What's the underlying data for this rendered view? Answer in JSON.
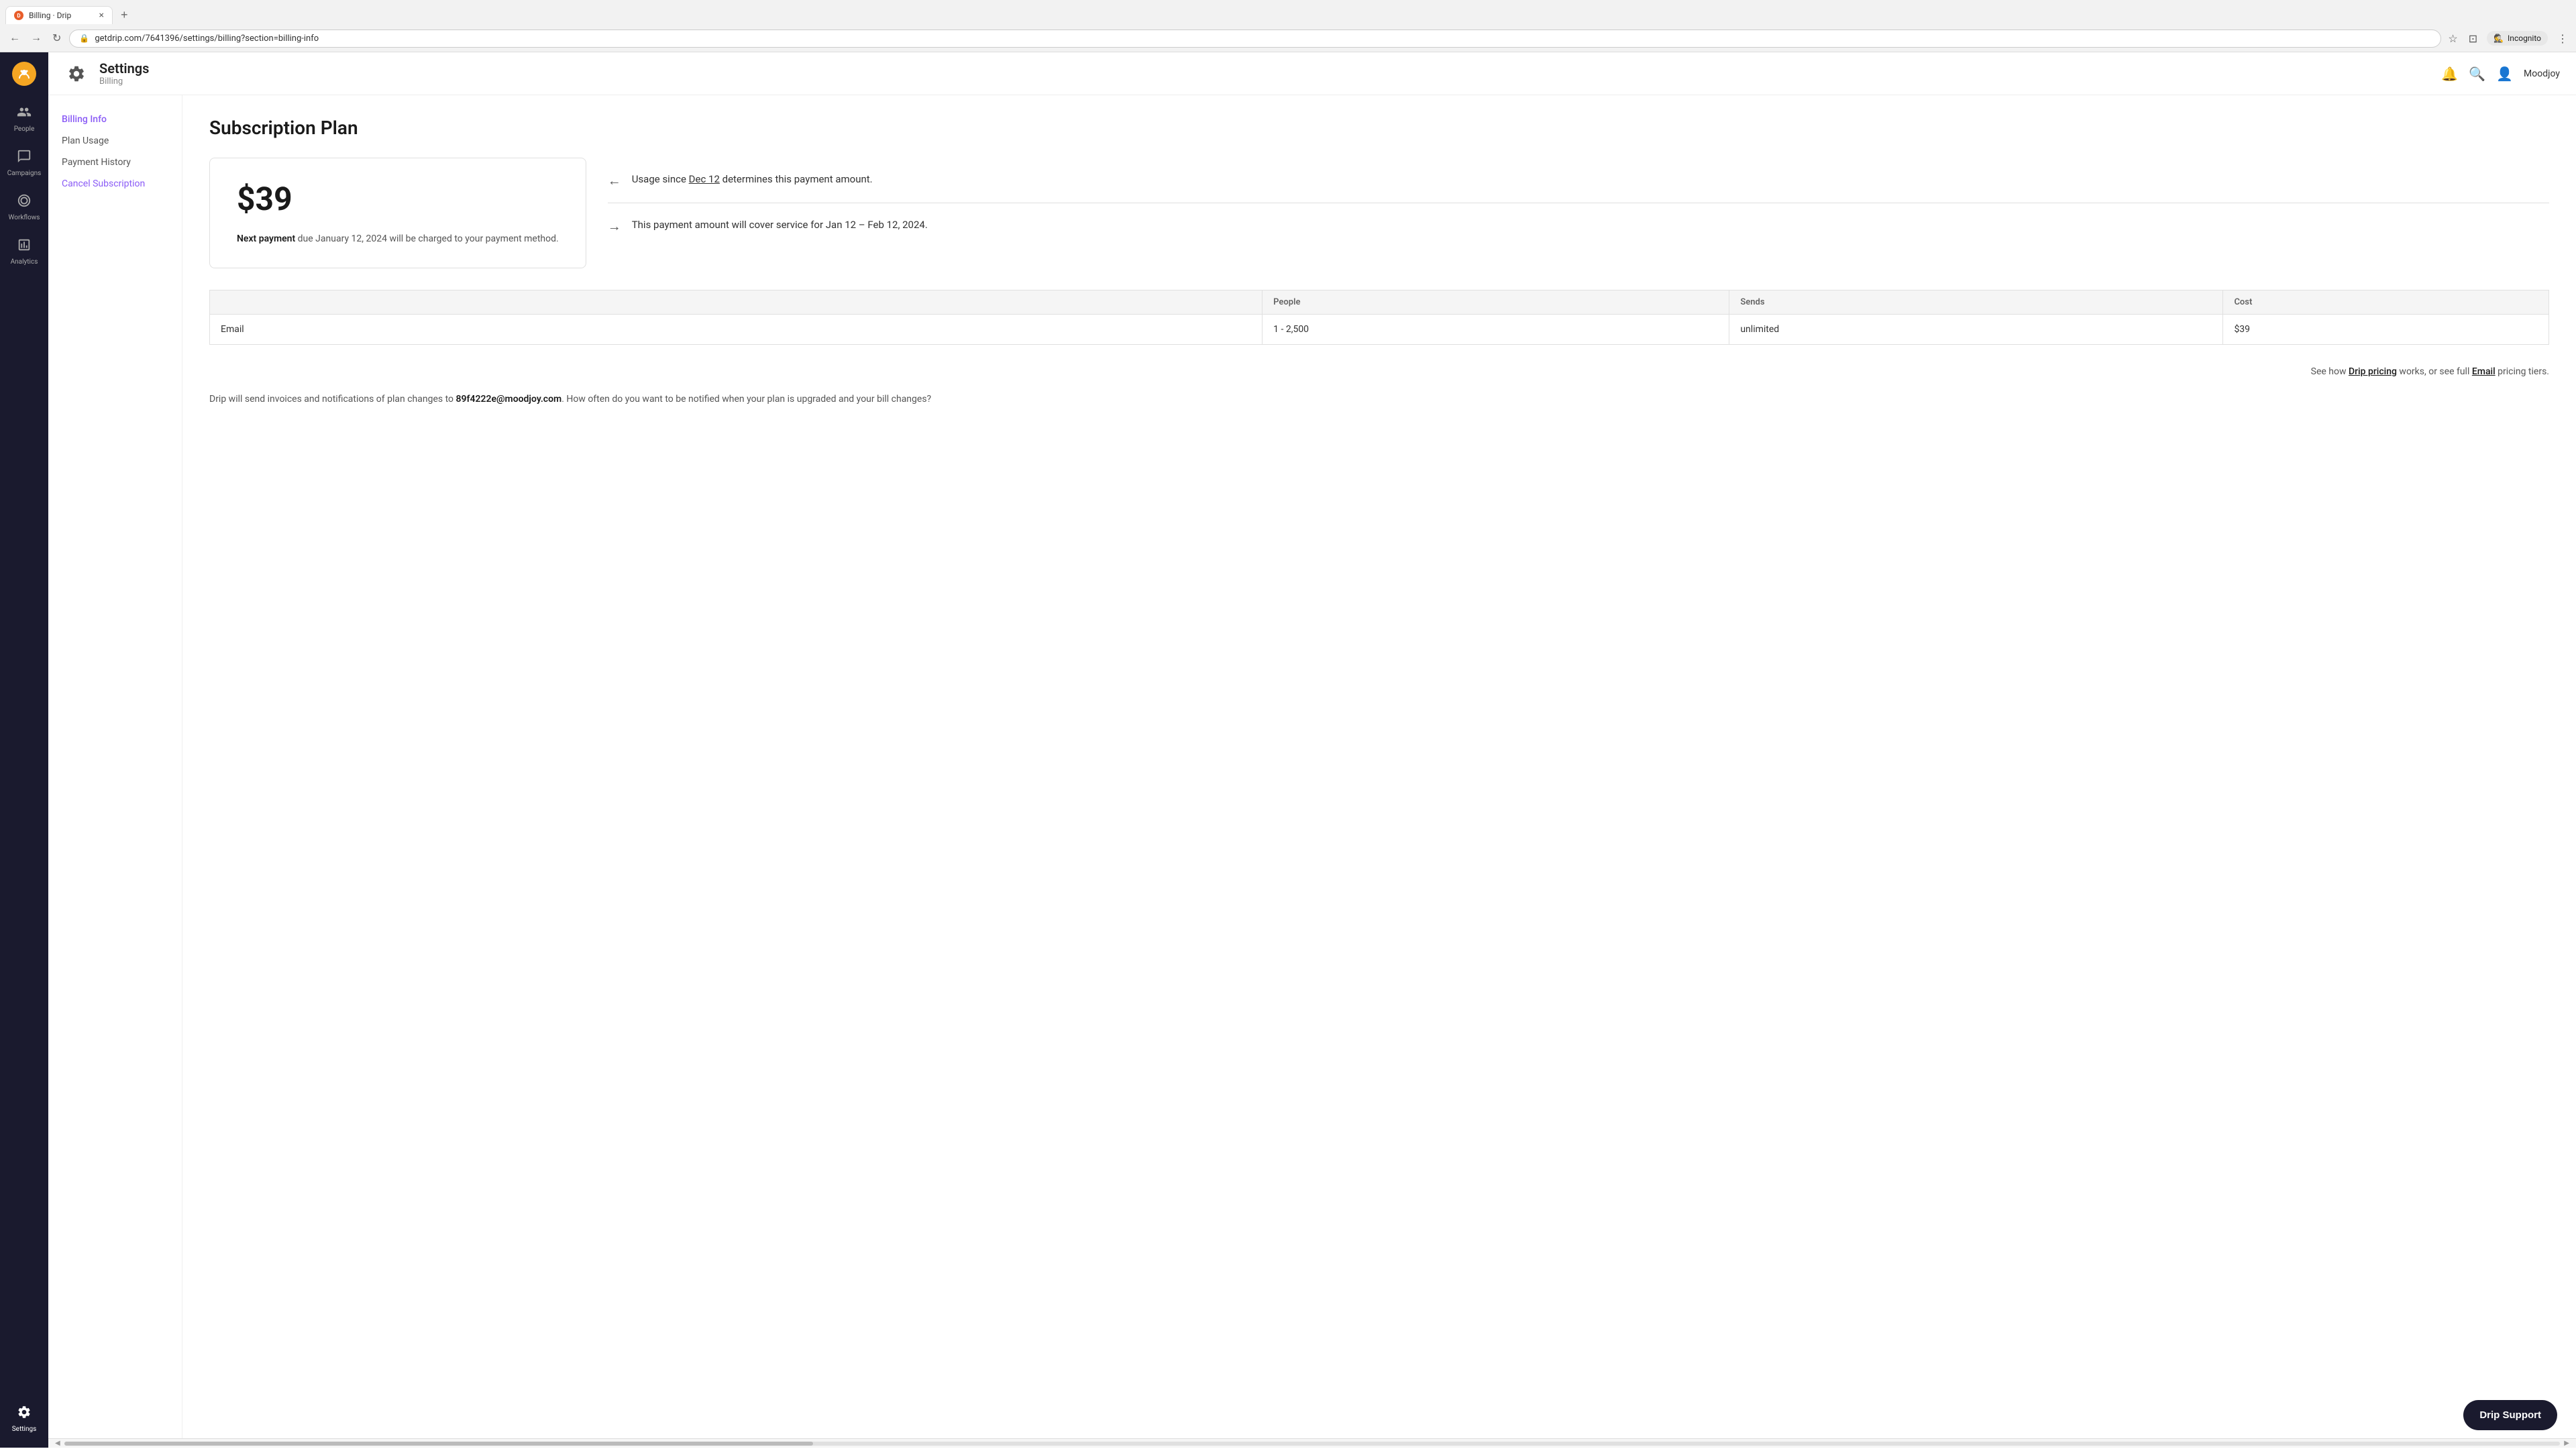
{
  "browser": {
    "tab_title": "Billing · Drip",
    "tab_close": "×",
    "new_tab": "+",
    "nav_back": "←",
    "nav_forward": "→",
    "nav_refresh": "↻",
    "address": "getdrip.com/7641396/settings/billing?section=billing-info",
    "incognito": "Incognito",
    "toolbar": {
      "star": "☆",
      "cast": "⊡",
      "menu": "⋮"
    }
  },
  "sidebar": {
    "logo": "☺",
    "items": [
      {
        "id": "people",
        "label": "People",
        "icon": "👥"
      },
      {
        "id": "campaigns",
        "label": "Campaigns",
        "icon": "📣"
      },
      {
        "id": "workflows",
        "label": "Workflows",
        "icon": "⬡"
      },
      {
        "id": "analytics",
        "label": "Analytics",
        "icon": "📊"
      }
    ],
    "settings": {
      "label": "Settings",
      "icon": "⚙"
    }
  },
  "header": {
    "settings_icon": "⚙",
    "title": "Settings",
    "subtitle": "Billing",
    "notification_icon": "🔔",
    "search_icon": "🔍",
    "user_icon": "👤",
    "user_name": "Moodjoy"
  },
  "secondary_nav": {
    "items": [
      {
        "id": "billing-info",
        "label": "Billing Info",
        "active": true
      },
      {
        "id": "plan-usage",
        "label": "Plan Usage",
        "active": false
      },
      {
        "id": "payment-history",
        "label": "Payment History",
        "active": false
      },
      {
        "id": "cancel-subscription",
        "label": "Cancel Subscription",
        "active": false
      }
    ]
  },
  "page": {
    "title": "Subscription Plan",
    "price_card": {
      "amount": "$39",
      "next_payment_label": "Next payment",
      "next_payment_text": "due January 12, 2024 will be charged to your payment method."
    },
    "info_panels": [
      {
        "arrow": "←",
        "text_parts": [
          "Usage since ",
          "Dec 12",
          " determines this payment amount."
        ]
      },
      {
        "arrow": "→",
        "text": "This payment amount will cover service for Jan 12 – Feb 12, 2024."
      }
    ],
    "table": {
      "headers": [
        "",
        "People",
        "Sends",
        "Cost"
      ],
      "rows": [
        {
          "type": "Email",
          "people": "1 - 2,500",
          "sends": "unlimited",
          "cost": "$39"
        }
      ]
    },
    "footer": {
      "pricing_line": "See how Drip pricing works, or see full Email pricing tiers.",
      "drip_pricing_link": "Drip pricing",
      "email_link": "Email",
      "invoice_text_before": "Drip will send invoices and notifications of plan changes to ",
      "invoice_email": "89f4222e@moodjoy.com",
      "invoice_text_after": ". How often do you want to be notified when your plan is upgraded and your bill changes?"
    }
  },
  "drip_support_btn": "Drip Support"
}
